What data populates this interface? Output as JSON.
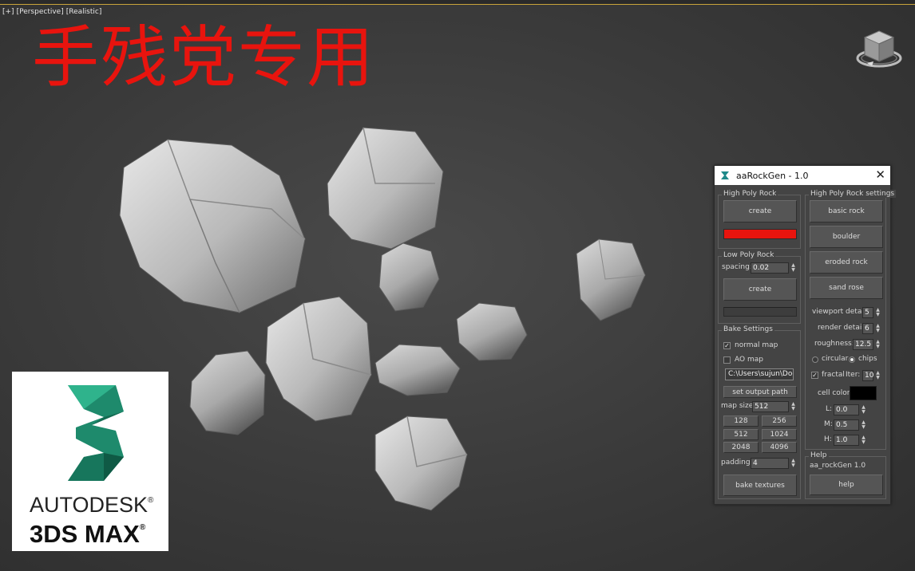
{
  "viewport": {
    "labels": [
      "[+]",
      "[Perspective]",
      "[Realistic]"
    ],
    "overlay_title": "手残党专用"
  },
  "logo": {
    "line1": "AUTODESK",
    "line2": "3DS MAX",
    "mark": "®"
  },
  "dialog": {
    "title": "aaRockGen - 1.0",
    "close": "✕",
    "high_poly": {
      "label": "High Poly Rock",
      "create": "create",
      "color": "#e8140e"
    },
    "low_poly": {
      "label": "Low Poly Rock",
      "spacing_label": "spacing:",
      "spacing_value": "0.02",
      "create": "create"
    },
    "bake": {
      "label": "Bake Settings",
      "normal_map": "normal map",
      "normal_map_checked": true,
      "ao_map": "AO map",
      "ao_map_checked": false,
      "path": "C:\\Users\\sujun\\Doc",
      "set_output_path": "set output path",
      "map_size_label": "map size:",
      "map_size_value": "512",
      "sizes": [
        "128",
        "256",
        "512",
        "1024",
        "2048",
        "4096"
      ],
      "padding_label": "padding:",
      "padding_value": "4",
      "bake_textures": "bake textures"
    },
    "hp_settings": {
      "label": "High Poly Rock settings",
      "presets": [
        "basic rock",
        "boulder",
        "eroded rock",
        "sand rose"
      ],
      "viewport_detail_label": "viewport detail:",
      "viewport_detail_value": "5",
      "render_detail_label": "render detail:",
      "render_detail_value": "6",
      "roughness_label": "roughness:",
      "roughness_value": "12.5",
      "circular": "circular",
      "chips": "chips",
      "selected": "chips",
      "fractal": "fractal",
      "fractal_checked": true,
      "iter_label": "Iter:",
      "iter_value": "10",
      "cell_color_label": "cell color:",
      "cell_color": "#000000",
      "L_label": "L:",
      "L_value": "0.0",
      "M_label": "M:",
      "M_value": "0.5",
      "H_label": "H:",
      "H_value": "1.0"
    },
    "help": {
      "label": "Help",
      "text": "aa_rockGen 1.0",
      "button": "help"
    }
  }
}
